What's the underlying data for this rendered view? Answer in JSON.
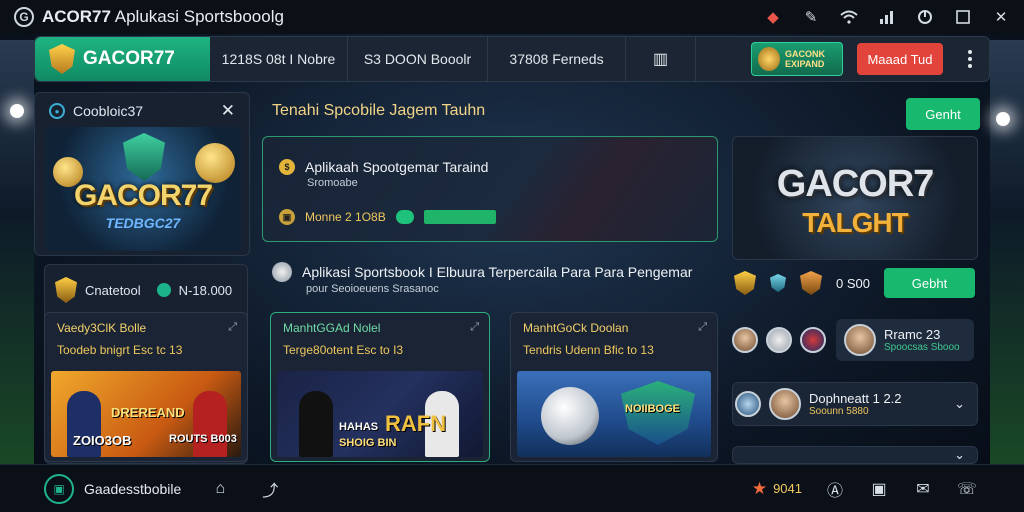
{
  "window": {
    "logo_glyph": "G",
    "title_bold": "ACOR77",
    "title_rest": "Aplukasi Sportsbooolg",
    "icons": [
      "alert-icon",
      "pen-icon",
      "wifi-icon",
      "signal-icon",
      "power-icon",
      "maximize-icon",
      "close-icon"
    ]
  },
  "nav": {
    "brand": "GACOR77",
    "tabs": [
      "1218S 08t I Nobre",
      "S3 DOON Booolr",
      "37808 Ferneds"
    ],
    "promo_line1": "GACONK",
    "promo_line2": "EXIPAND",
    "red_button": "Maaad Tud"
  },
  "sidebar": {
    "header": "Coobloic37",
    "close": "✕",
    "hero_title": "GACOR77",
    "hero_sub": "TEDBGC27",
    "sub_header": "Cnatetool",
    "sub_odds": "N-18.000"
  },
  "main": {
    "title": "Tenahi Spcobile Jagem Tauhn",
    "top_button": "Genht",
    "feature": {
      "title": "Aplikaah Spootgemar Taraind",
      "sub": "Sromoabe",
      "row_text": "Monne 2 1O8B"
    },
    "hero_title": "GACOR7",
    "hero_sub": "TALGHT",
    "section_title": "Aplikasi Sportsbook I Elbuura Terpercaila Para Para Pengemar",
    "section_sub": "pour Seoioeuens Srasanoc",
    "cards": [
      {
        "title": "Vaedy3ClK Bolle",
        "sub": "Toodeb bnigrt Esc tc 13",
        "img_text_1": "DREREAND",
        "img_text_2": "ZOIO3OB",
        "img_text_3": "ROUTS B003"
      },
      {
        "title": "ManhtGGAd Nolel",
        "sub": "Terge80otent Esc to I3",
        "img_text_1": "RAFN",
        "img_text_2": "HAHAS",
        "img_text_3": "SHOIG BIN"
      },
      {
        "title": "ManhtGoCk Doolan",
        "sub": "Tendris Udenn Bfic to 13",
        "img_text_1": "NOIIBOGE",
        "img_text_2": "",
        "img_text_3": ""
      }
    ]
  },
  "right": {
    "odds": "0 S00",
    "button": "Gebht",
    "matches": [
      {
        "name": "Rramc 23",
        "sub": "Spoocsas Sbooo"
      },
      {
        "name": "Dophneatt 1 2.2",
        "sub": "Soounn 5880"
      },
      {
        "name": "",
        "sub": ""
      }
    ]
  },
  "bottom": {
    "label": "Gaadesstbobile",
    "score": "9041",
    "icons": [
      "home-icon",
      "share-icon",
      "star-icon",
      "android-icon",
      "wallet-icon",
      "mail-icon",
      "support-icon"
    ]
  },
  "colors": {
    "accent": "#18b86e",
    "gold": "#f0c85c",
    "red": "#e2433a"
  }
}
